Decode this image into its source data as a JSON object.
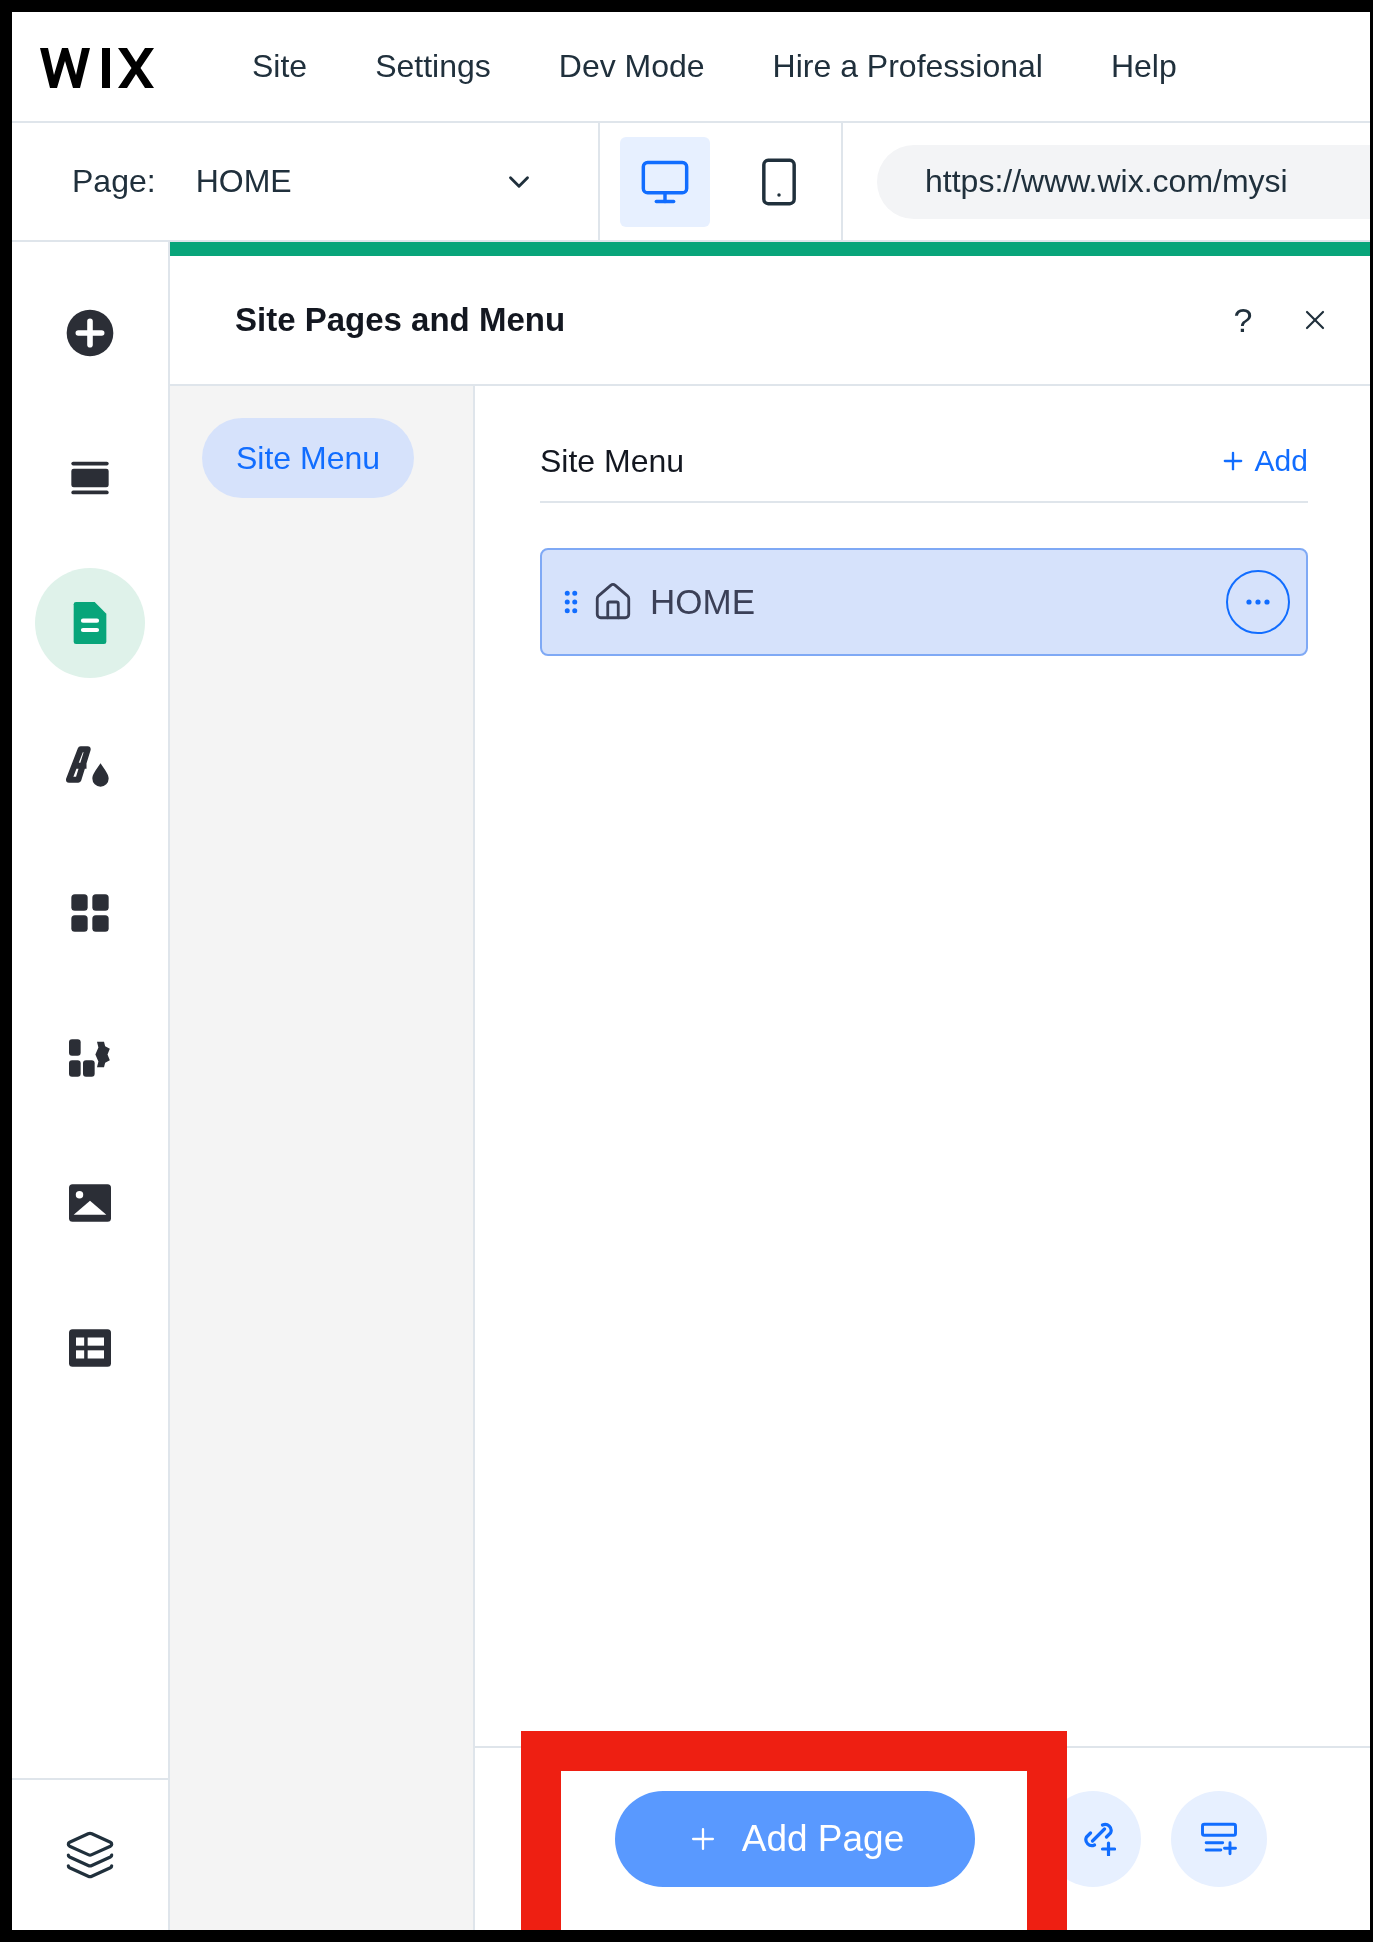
{
  "top_menu": [
    {
      "label": "Site"
    },
    {
      "label": "Settings"
    },
    {
      "label": "Dev Mode"
    },
    {
      "label": "Hire a Professional"
    },
    {
      "label": "Help"
    }
  ],
  "toolbar": {
    "page_label": "Page:",
    "page_value": "HOME",
    "devices": [
      {
        "kind": "desktop",
        "selected": true
      },
      {
        "kind": "mobile",
        "selected": false
      }
    ],
    "url": "https://www.wix.com/mysi"
  },
  "sidebar_tools": [
    {
      "kind": "add",
      "selected": false
    },
    {
      "kind": "sections",
      "selected": false
    },
    {
      "kind": "pages",
      "selected": true
    },
    {
      "kind": "design",
      "selected": false
    },
    {
      "kind": "apps",
      "selected": false
    },
    {
      "kind": "business",
      "selected": false
    },
    {
      "kind": "media",
      "selected": false
    },
    {
      "kind": "cms",
      "selected": false
    }
  ],
  "panel": {
    "title": "Site Pages and Menu",
    "help": "?",
    "nav": [
      {
        "label": "Site Menu",
        "selected": true
      }
    ],
    "section_heading": "Site Menu",
    "add_link": "Add",
    "pages": [
      {
        "label": "HOME",
        "selected": true
      }
    ],
    "add_page_button": "Add Page"
  },
  "annotation": {
    "kind": "highlight",
    "color": "#ee1f12"
  }
}
